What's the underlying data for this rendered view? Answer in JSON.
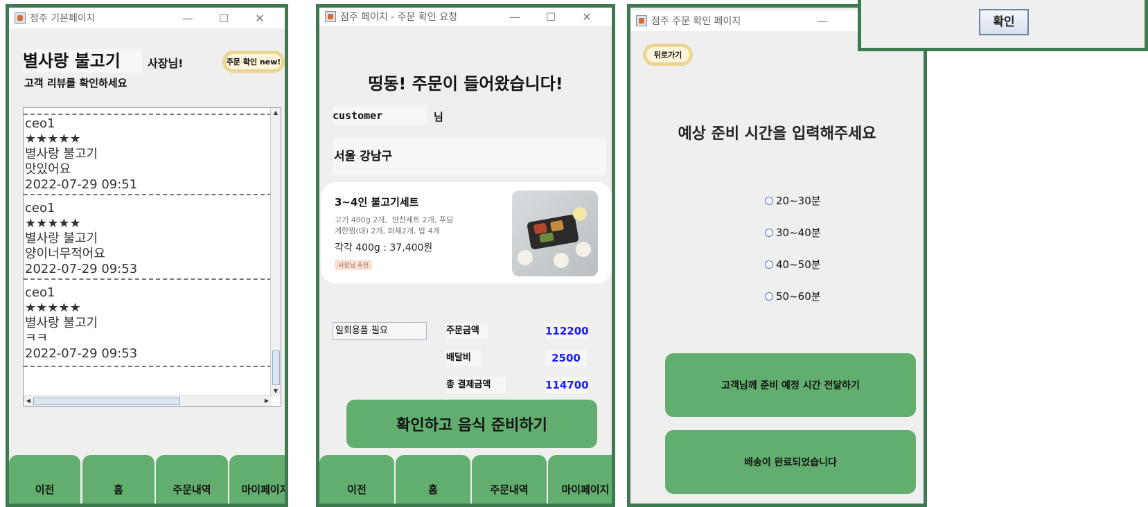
{
  "w1": {
    "title": "점주 기본페이지",
    "store_name": "별사랑 불고기",
    "owner_label": "사장님!",
    "subtitle": "고객 리뷰를 확인하세요",
    "order_check_button": "주문 확인 new!",
    "reviews": [
      {
        "user": "ceo1",
        "stars": "★★★★★",
        "menu": "별사랑 불고기",
        "text": "맛있어요",
        "date": "2022-07-29 09:51"
      },
      {
        "user": "ceo1",
        "stars": "★★★★★",
        "menu": "별사랑 불고기",
        "text": "양이너무적어요",
        "date": "2022-07-29 09:53"
      },
      {
        "user": "ceo1",
        "stars": "★★★★★",
        "menu": "별사랑 불고기",
        "text": "ㅋㅋ",
        "date": "2022-07-29 09:53"
      }
    ],
    "tabs": [
      "이전",
      "홈",
      "주문내역",
      "마이페이지"
    ]
  },
  "w2": {
    "title": "점주 페이지 - 주문 확인 요청",
    "heading": "띵동! 주문이 들어왔습니다!",
    "customer": "customer",
    "customer_suffix": "님",
    "address": "서울 강남구",
    "product_name": "3~4인 불고기세트",
    "product_desc_1": "고기 400g 2개,  반찬세트 2개, 푸딩",
    "product_desc_2": "계란찜(대) 2개, 파채2개, 밥 4개",
    "product_price": "각각 400g : 37,400원",
    "product_badge": "사장님 추천",
    "disposable": "일회용품 필요",
    "order_amount_label": "주문금액",
    "order_amount": "112200",
    "delivery_fee_label": "배달비",
    "delivery_fee": "2500",
    "total_label": "총 결제금액",
    "total": "114700",
    "confirm_button": "확인하고 음식 준비하기",
    "tabs": [
      "이전",
      "홈",
      "주문내역",
      "마이페이지"
    ]
  },
  "w3": {
    "title": "점주 주문 확인 페이지",
    "back_button": "뒤로가기",
    "heading": "예상 준비 시간을 입력해주세요",
    "options": [
      "20~30분",
      "30~40분",
      "40~50분",
      "50~60분"
    ],
    "send_button": "고객님께 준비 예정 시간 전달하기",
    "delivered_button": "배송이 완료되었습니다"
  },
  "dialog": {
    "ok_button": "확인"
  },
  "colors": {
    "frame_border": "#3d7a4f",
    "button_green": "#62ae6f",
    "amount_blue": "#1a1aff"
  }
}
